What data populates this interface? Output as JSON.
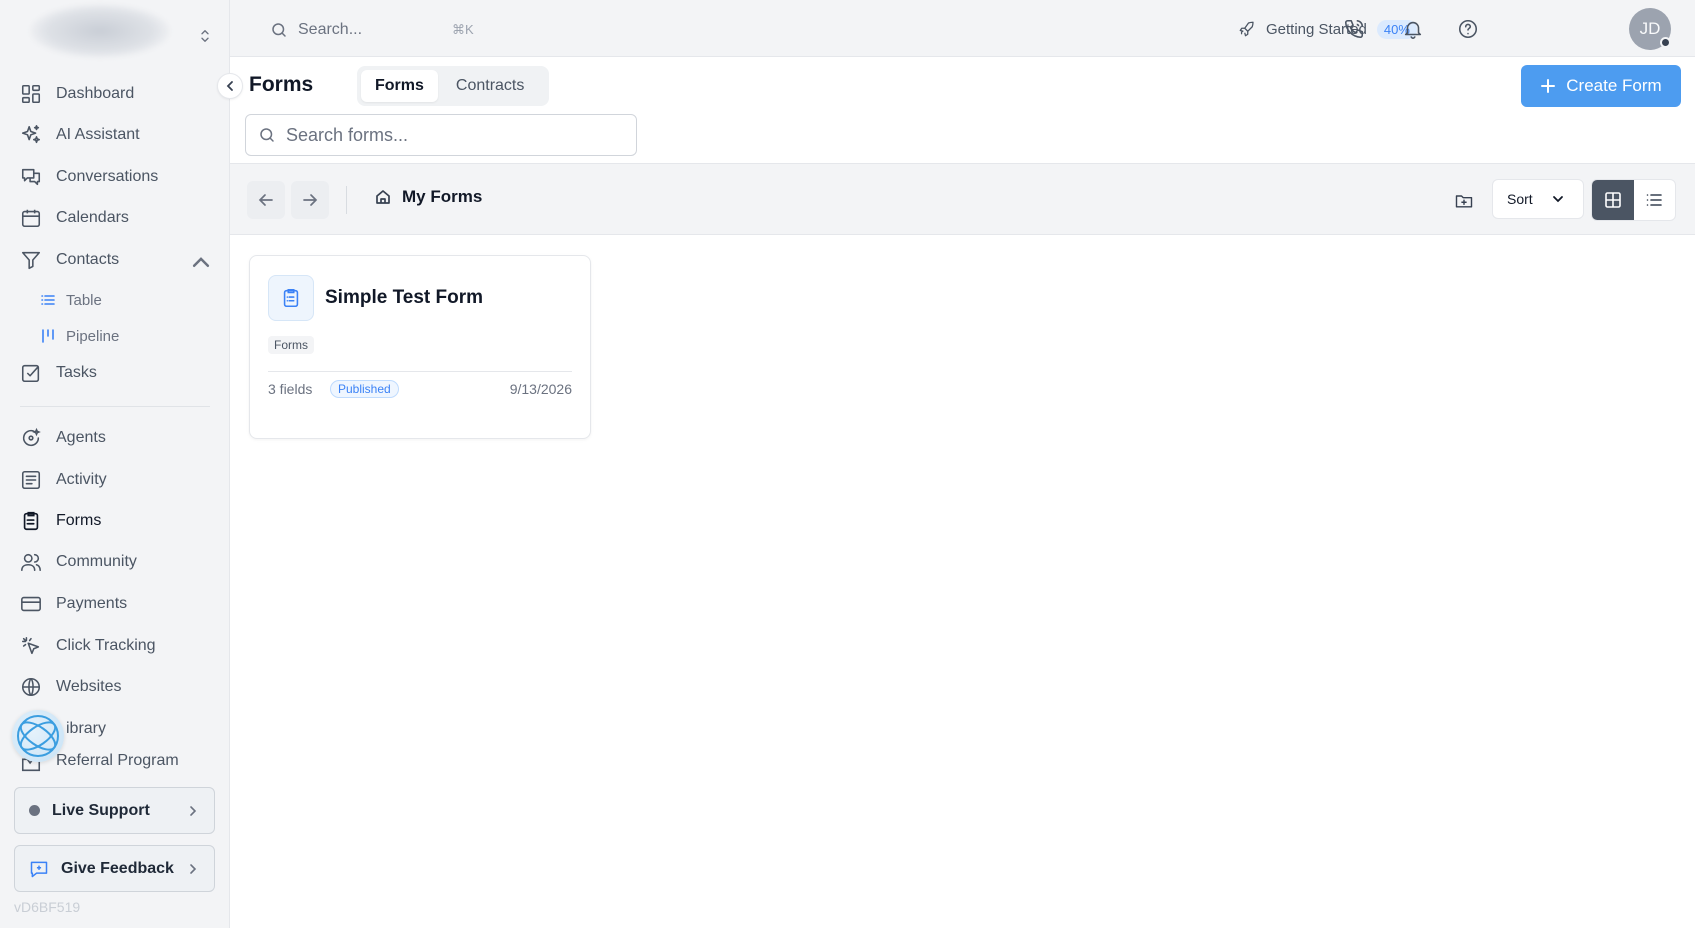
{
  "sidebar": {
    "items": [
      {
        "label": "Dashboard",
        "icon": "dashboard-icon"
      },
      {
        "label": "AI Assistant",
        "icon": "sparkles-icon"
      },
      {
        "label": "Conversations",
        "icon": "chat-icon"
      },
      {
        "label": "Calendars",
        "icon": "calendar-icon"
      },
      {
        "label": "Contacts",
        "icon": "filter-icon"
      },
      {
        "label": "Tasks",
        "icon": "checkbox-icon"
      },
      {
        "label": "Agents",
        "icon": "agent-icon"
      },
      {
        "label": "Activity",
        "icon": "activity-icon"
      },
      {
        "label": "Forms",
        "icon": "clipboard-icon"
      },
      {
        "label": "Community",
        "icon": "users-icon"
      },
      {
        "label": "Payments",
        "icon": "credit-card-icon"
      },
      {
        "label": "Click Tracking",
        "icon": "cursor-click-icon"
      },
      {
        "label": "Websites",
        "icon": "globe-icon"
      },
      {
        "label": "ibrary",
        "icon": "library-icon"
      },
      {
        "label": "Referral Program",
        "icon": "referral-icon"
      }
    ],
    "contacts_sub": [
      {
        "label": "Table",
        "icon": "list-icon"
      },
      {
        "label": "Pipeline",
        "icon": "pipeline-icon"
      }
    ],
    "live_support": "Live Support",
    "give_feedback": "Give Feedback",
    "version": "vD6BF519"
  },
  "topbar": {
    "search_placeholder": "Search...",
    "search_shortcut": "⌘K",
    "getting_started_label": "Getting Started",
    "getting_started_progress": "40%",
    "avatar_initials": "JD"
  },
  "page": {
    "title": "Forms",
    "tabs": [
      {
        "label": "Forms",
        "active": true
      },
      {
        "label": "Contracts",
        "active": false
      }
    ],
    "create_button": "Create Form",
    "search_placeholder": "Search forms..."
  },
  "toolbar": {
    "breadcrumb": "My Forms",
    "sort_label": "Sort",
    "view_mode": "grid"
  },
  "forms": [
    {
      "title": "Simple Test Form",
      "tag": "Forms",
      "fields": "3 fields",
      "status": "Published",
      "date": "9/13/2026"
    }
  ],
  "colors": {
    "accent": "#4d9cf0",
    "status_published": "#3b82f6"
  }
}
